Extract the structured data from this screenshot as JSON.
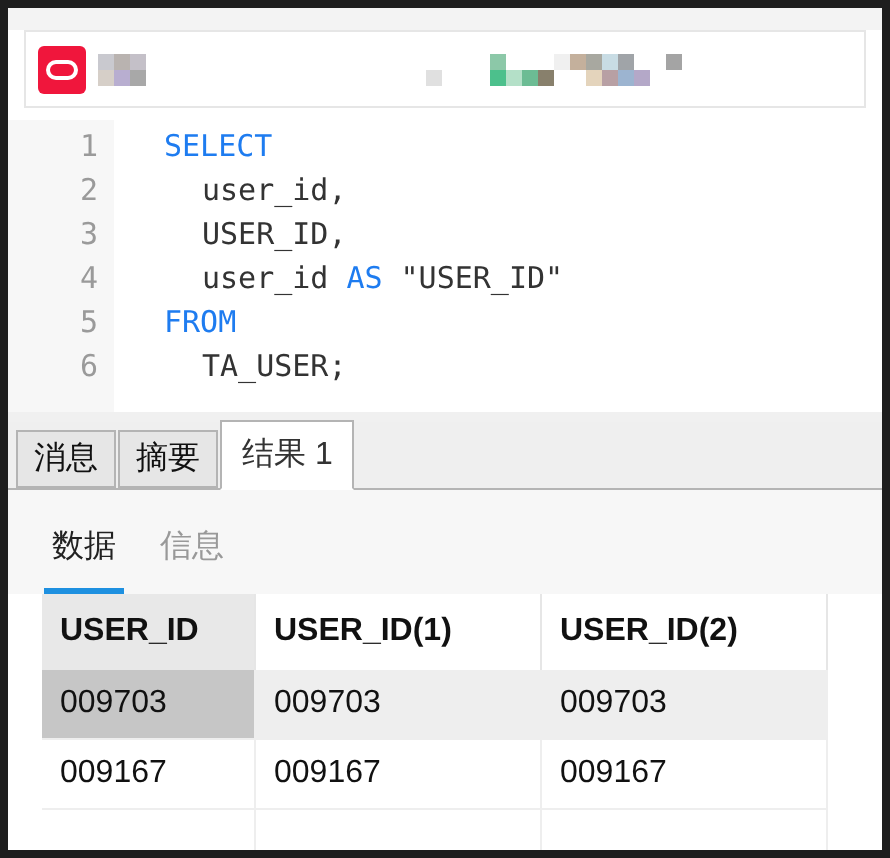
{
  "code_lines": [
    {
      "number": "1",
      "tokens": [
        {
          "kind": "keyword",
          "text": "SELECT"
        }
      ],
      "indent": false
    },
    {
      "number": "2",
      "tokens": [
        {
          "kind": "plain",
          "text": "user_id,"
        }
      ],
      "indent": true
    },
    {
      "number": "3",
      "tokens": [
        {
          "kind": "plain",
          "text": "USER_ID,"
        }
      ],
      "indent": true
    },
    {
      "number": "4",
      "tokens": [
        {
          "kind": "plain",
          "text": "user_id"
        },
        {
          "kind": "keyword",
          "text": "AS"
        },
        {
          "kind": "plain",
          "text": "\"USER_ID\""
        }
      ],
      "indent": true
    },
    {
      "number": "5",
      "tokens": [
        {
          "kind": "keyword",
          "text": "FROM"
        }
      ],
      "indent": false
    },
    {
      "number": "6",
      "tokens": [
        {
          "kind": "plain",
          "text": "TA_USER;"
        }
      ],
      "indent": true
    }
  ],
  "result_tabs": [
    {
      "label": "消息",
      "selected": false
    },
    {
      "label": "摘要",
      "selected": false
    },
    {
      "label": "结果 1",
      "selected": true
    }
  ],
  "sub_tabs": [
    {
      "label": "数据",
      "selected": true
    },
    {
      "label": "信息",
      "selected": false
    }
  ],
  "table": {
    "columns": [
      "USER_ID",
      "USER_ID(1)",
      "USER_ID(2)"
    ],
    "rows": [
      {
        "cells": [
          "009703",
          "009703",
          "009703"
        ],
        "selected": true
      },
      {
        "cells": [
          "009167",
          "009167",
          "009167"
        ],
        "selected": false
      }
    ]
  }
}
